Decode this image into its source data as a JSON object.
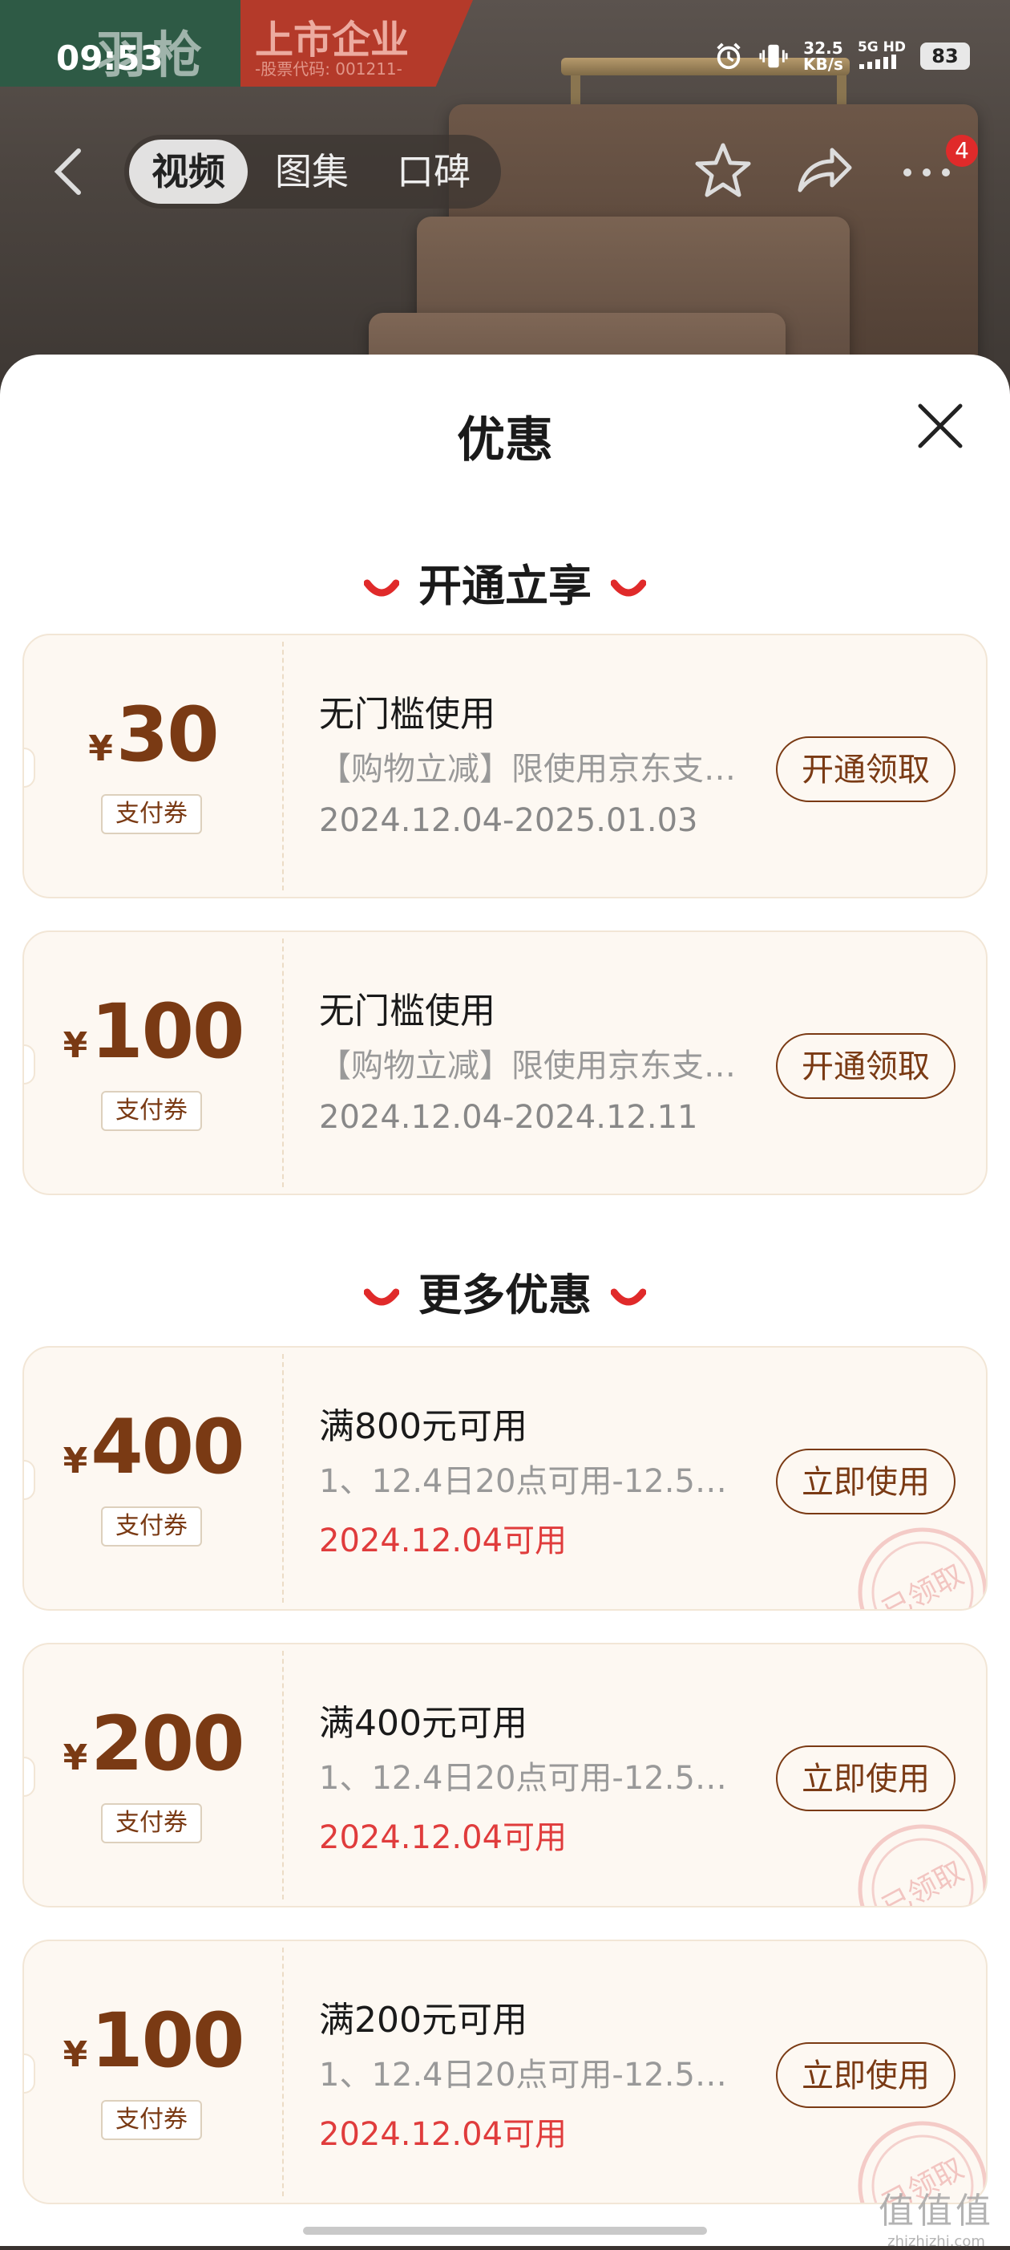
{
  "status_bar": {
    "time": "09:53",
    "speed_value": "32.5",
    "speed_unit": "KB/s",
    "network_top": "5G HD",
    "battery": "83"
  },
  "banner": {
    "brand_logo": "羽枪",
    "title": "上市企业",
    "subtitle": "-股票代码: 001211-"
  },
  "nav": {
    "tabs": [
      {
        "label": "视频",
        "active": true
      },
      {
        "label": "图集"
      },
      {
        "label": "口碑"
      }
    ],
    "more_badge": "4"
  },
  "sheet": {
    "title": "优惠"
  },
  "sections": [
    {
      "title": "开通立享",
      "coupons": [
        {
          "currency": "¥",
          "amount": "30",
          "tag": "支付券",
          "title": "无门槛使用",
          "desc": "【购物立减】限使用京东支付…",
          "date": "2024.12.04-2025.01.03",
          "button": "开通领取",
          "claimed": false
        },
        {
          "currency": "¥",
          "amount": "100",
          "tag": "支付券",
          "title": "无门槛使用",
          "desc": "【购物立减】限使用京东支付…",
          "date": "2024.12.04-2024.12.11",
          "button": "开通领取",
          "claimed": false
        }
      ]
    },
    {
      "title": "更多优惠",
      "coupons": [
        {
          "currency": "¥",
          "amount": "400",
          "tag": "支付券",
          "title": "满800元可用",
          "desc": "1、12.4日20点可用-12.5…",
          "date": "2024.12.04可用",
          "button": "立即使用",
          "claimed": true
        },
        {
          "currency": "¥",
          "amount": "200",
          "tag": "支付券",
          "title": "满400元可用",
          "desc": "1、12.4日20点可用-12.5…",
          "date": "2024.12.04可用",
          "button": "立即使用",
          "claimed": true
        },
        {
          "currency": "¥",
          "amount": "100",
          "tag": "支付券",
          "title": "满200元可用",
          "desc": "1、12.4日20点可用-12.5…",
          "date": "2024.12.04可用",
          "button": "立即使用",
          "claimed": true
        }
      ]
    }
  ],
  "stamp_text": "已领取",
  "watermark": {
    "logo": "值值值",
    "url": "zhizhizhi.com"
  },
  "colors": {
    "accent": "#7a3a14",
    "date_red": "#e03c3c",
    "smile_red": "#e02a2a"
  }
}
